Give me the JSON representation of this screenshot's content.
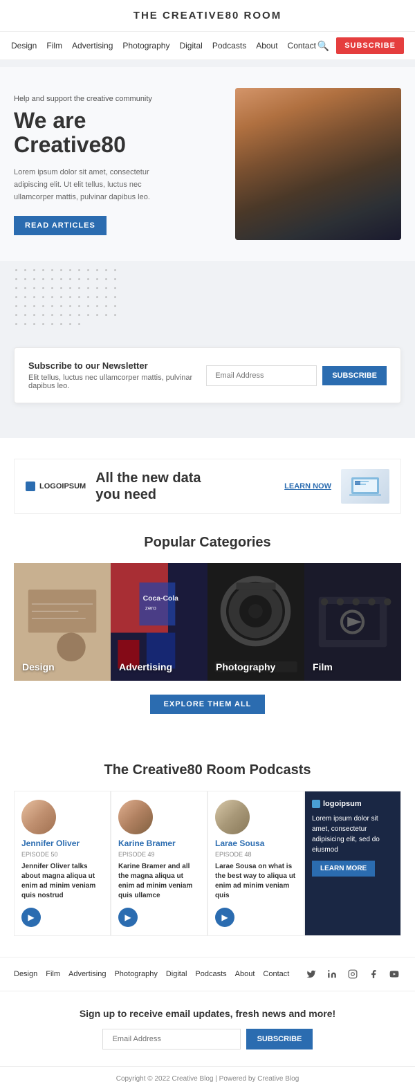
{
  "header": {
    "title": "THE CREATIVE80 ROOM"
  },
  "nav": {
    "links": [
      "Design",
      "Film",
      "Advertising",
      "Photography",
      "Digital",
      "Podcasts",
      "About",
      "Contact"
    ],
    "subscribe_label": "SUBSCRIBE"
  },
  "hero": {
    "tagline": "Help and support the creative community",
    "title_line1": "We are",
    "title_line2": "Creative80",
    "description": "Lorem ipsum dolor sit amet, consectetur adipiscing elit. Ut elit tellus, luctus nec ullamcorper mattis, pulvinar dapibus leo.",
    "cta_label": "READ ARTICLES"
  },
  "newsletter_banner": {
    "title": "Subscribe to our Newsletter",
    "description": "Elit tellus, luctus nec ullamcorper mattis, pulvinar dapibus leo.",
    "input_placeholder": "Email Address",
    "btn_label": "SUBSCRIBE"
  },
  "ad_banner": {
    "logo_text": "LOGOIPSUM",
    "headline_line1": "All the new data",
    "headline_line2": "you need",
    "learn_now": "LEARN NOW"
  },
  "categories": {
    "section_title": "Popular Categories",
    "items": [
      {
        "label": "Design",
        "theme": "cat-design"
      },
      {
        "label": "Advertising",
        "theme": "cat-advertising"
      },
      {
        "label": "Photography",
        "theme": "cat-photography"
      },
      {
        "label": "Film",
        "theme": "cat-film"
      }
    ],
    "explore_btn": "EXPLORE THEM ALL"
  },
  "podcasts": {
    "section_title": "The Creative80 Room Podcasts",
    "items": [
      {
        "host": "Jennifer Oliver",
        "episode": "EPISODE 50",
        "description": "Jennifer Oliver talks about magna aliqua ut enim ad minim veniam quis nostrud"
      },
      {
        "host": "Karine Bramer",
        "episode": "EPISODE 49",
        "description": "Karine Bramer and all the magna aliqua ut enim ad minim veniam quis ullamce"
      },
      {
        "host": "Larae Sousa",
        "episode": "EPISODE 48",
        "description": "Larae Sousa on what is the best way to aliqua ut enim ad minim veniam quis"
      }
    ],
    "dark_card": {
      "logo": "logoipsum",
      "text": "Lorem ipsum dolor sit amet, consectetur adipisicing elit, sed do eiusmod",
      "learn_more": "LEARN MORE"
    }
  },
  "footer_nav": {
    "links": [
      "Design",
      "Film",
      "Advertising",
      "Photography",
      "Digital",
      "Podcasts",
      "About",
      "Contact"
    ],
    "social": [
      "twitter",
      "linkedin",
      "instagram",
      "facebook",
      "youtube"
    ]
  },
  "footer_newsletter": {
    "title": "Sign up to receive email updates, fresh news and more!",
    "input_placeholder": "Email Address",
    "btn_label": "SUBSCRIBE"
  },
  "copyright": "Copyright © 2022 Creative Blog | Powered by Creative Blog"
}
